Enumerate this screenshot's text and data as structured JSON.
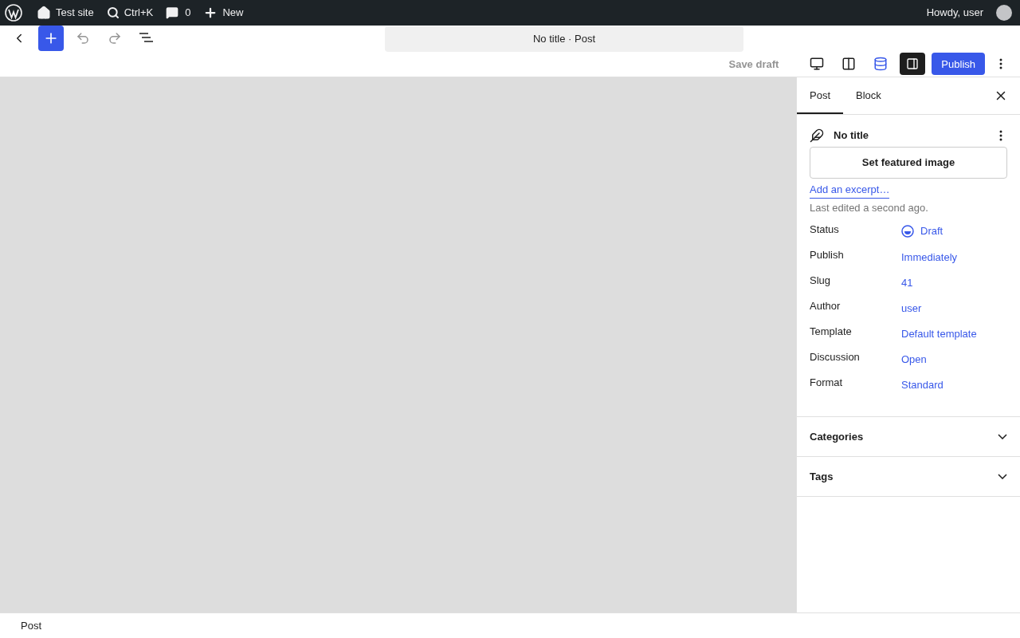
{
  "admin_bar": {
    "site": "Test site",
    "search": "Ctrl+K",
    "comments": "0",
    "new": "New",
    "greeting": "Howdy, user"
  },
  "toolbar": {
    "document_title": "No title · Post",
    "save_draft": "Save draft",
    "publish": "Publish",
    "settings_open": true
  },
  "sidebar": {
    "tabs": [
      {
        "label": "Post",
        "selected": true
      },
      {
        "label": "Block",
        "selected": false
      }
    ],
    "post_title": "No title",
    "featured_image": "Set featured image",
    "excerpt_link": "Add an excerpt…",
    "last_edited": "Last edited a second ago.",
    "fields": [
      {
        "label": "Status",
        "value": "Draft",
        "kind": "status"
      },
      {
        "label": "Publish",
        "value": "Immediately",
        "kind": "link"
      },
      {
        "label": "Slug",
        "value": "41",
        "kind": "link"
      },
      {
        "label": "Author",
        "value": "user",
        "kind": "link"
      },
      {
        "label": "Template",
        "value": "Default template",
        "kind": "link"
      },
      {
        "label": "Discussion",
        "value": "Open",
        "kind": "link"
      },
      {
        "label": "Format",
        "value": "Standard",
        "kind": "link"
      }
    ],
    "panels": [
      {
        "title": "Categories",
        "expanded": false
      },
      {
        "title": "Tags",
        "expanded": false
      }
    ]
  },
  "footer": {
    "breadcrumb": "Post"
  }
}
